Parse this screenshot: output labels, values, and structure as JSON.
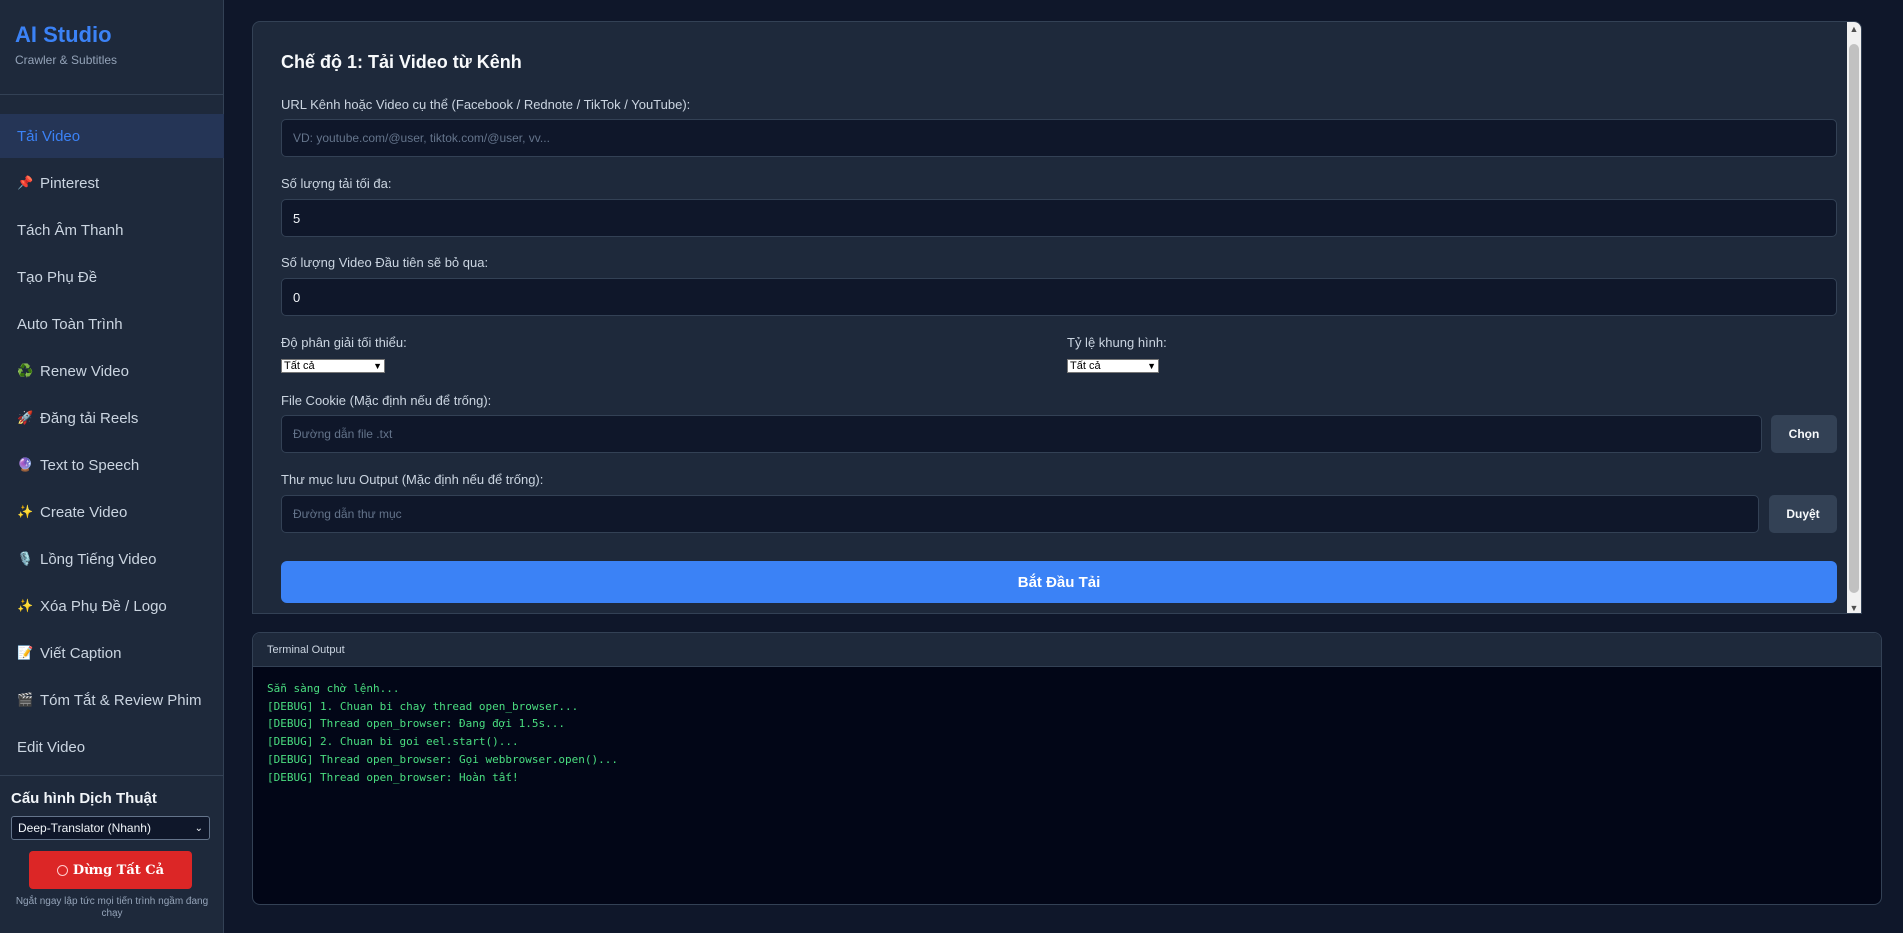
{
  "brand": {
    "title": "AI Studio",
    "subtitle": "Crawler & Subtitles"
  },
  "sidebar": {
    "items": [
      {
        "label": "Tải Video",
        "icon": "",
        "active": true
      },
      {
        "label": "Pinterest",
        "icon": "📌"
      },
      {
        "label": "Tách Âm Thanh",
        "icon": ""
      },
      {
        "label": "Tạo Phụ Đề",
        "icon": ""
      },
      {
        "label": "Auto Toàn Trình",
        "icon": ""
      },
      {
        "label": "Renew Video",
        "icon": "♻️"
      },
      {
        "label": "Đăng tải Reels",
        "icon": "🚀"
      },
      {
        "label": "Text to Speech",
        "icon": "🔮"
      },
      {
        "label": "Create Video",
        "icon": "✨"
      },
      {
        "label": "Lồng Tiếng Video",
        "icon": "🎙️"
      },
      {
        "label": "Xóa Phụ Đề / Logo",
        "icon": "✨"
      },
      {
        "label": "Viết Caption",
        "icon": "📝"
      },
      {
        "label": "Tóm Tắt & Review Phim",
        "icon": "🎬"
      },
      {
        "label": "Edit Video",
        "icon": ""
      }
    ],
    "translation": {
      "heading": "Cấu hình Dịch Thuật",
      "selected": "Deep-Translator (Nhanh)",
      "stop_label": "Dừng Tất Cả",
      "stop_note": "Ngắt ngay lập tức mọi tiến trình ngầm đang chạy"
    }
  },
  "main": {
    "title": "Chế độ 1: Tải Video từ Kênh",
    "url": {
      "label": "URL Kênh hoặc Video cụ thể (Facebook / Rednote / TikTok / YouTube):",
      "placeholder": "VD: youtube.com/@user, tiktok.com/@user, vv..."
    },
    "max_count": {
      "label": "Số lượng tải tối đa:",
      "value": "5"
    },
    "skip_count": {
      "label": "Số lượng Video Đầu tiên sẽ bỏ qua:",
      "value": "0"
    },
    "resolution": {
      "label": "Độ phân giải tối thiểu:",
      "selected": "Tất cả"
    },
    "aspect": {
      "label": "Tỷ lệ khung hình:",
      "selected": "Tất cả"
    },
    "cookie": {
      "label": "File Cookie (Mặc định nếu để trống):",
      "placeholder": "Đường dẫn file .txt",
      "button": "Chọn"
    },
    "output": {
      "label": "Thư mục lưu Output (Mặc định nếu để trống):",
      "placeholder": "Đường dẫn thư mục",
      "button": "Duyệt"
    },
    "start_label": "Bắt Đầu Tải"
  },
  "terminal": {
    "title": "Terminal Output",
    "lines": [
      "Sẵn sàng chờ lệnh...",
      "[DEBUG] 1. Chuan bi chay thread open_browser...",
      "[DEBUG] Thread open_browser: Đang đợi 1.5s...",
      "[DEBUG] 2. Chuan bi goi eel.start()...",
      "[DEBUG] Thread open_browser: Gọi webbrowser.open()...",
      "[DEBUG] Thread open_browser: Hoàn tất!"
    ]
  }
}
